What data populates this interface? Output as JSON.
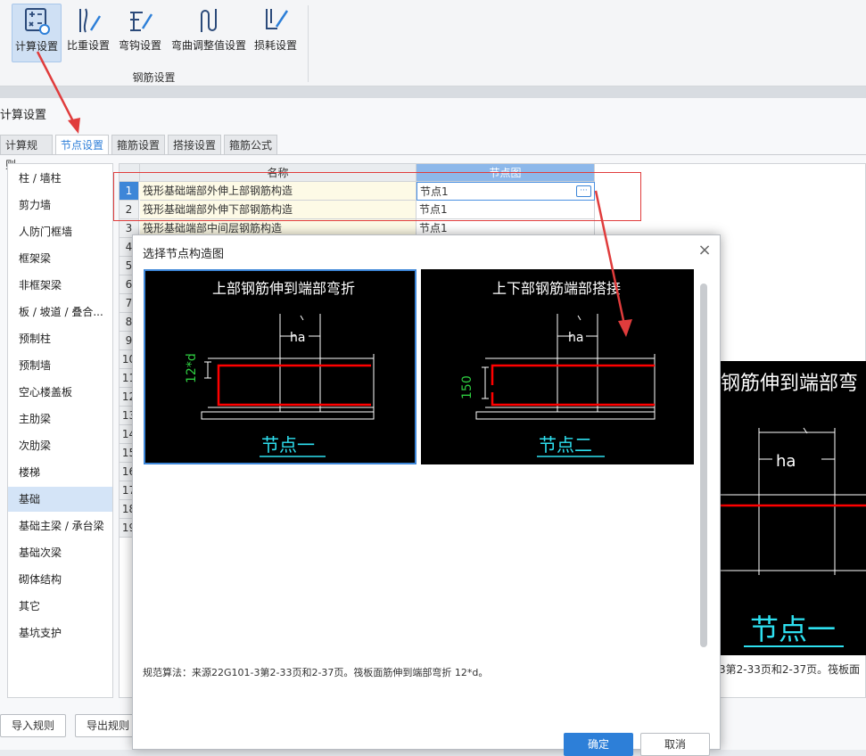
{
  "ribbon": {
    "buttons": [
      {
        "label": "计算设置",
        "icon": "calc-settings-icon"
      },
      {
        "label": "比重设置",
        "icon": "weight-settings-icon"
      },
      {
        "label": "弯钩设置",
        "icon": "hook-settings-icon"
      },
      {
        "label": "弯曲调整值设置",
        "icon": "bend-adjust-icon"
      },
      {
        "label": "损耗设置",
        "icon": "loss-settings-icon"
      }
    ],
    "group_label": "钢筋设置"
  },
  "calc_window": {
    "title": "计算设置",
    "tabs": [
      "计算规则",
      "节点设置",
      "箍筋设置",
      "搭接设置",
      "箍筋公式"
    ],
    "categories": [
      "柱 / 墙柱",
      "剪力墙",
      "人防门框墙",
      "框架梁",
      "非框架梁",
      "板 / 坡道 / 叠合...",
      "预制柱",
      "预制墙",
      "空心楼盖板",
      "主肋梁",
      "次肋梁",
      "楼梯",
      "基础",
      "基础主梁 / 承台梁",
      "基础次梁",
      "砌体结构",
      "其它",
      "基坑支护"
    ],
    "grid": {
      "headers": [
        "名称",
        "节点图"
      ],
      "rows": [
        {
          "num": "1",
          "name": "筏形基础端部外伸上部钢筋构造",
          "node": "节点1"
        },
        {
          "num": "2",
          "name": "筏形基础端部外伸下部钢筋构造",
          "node": "节点1"
        },
        {
          "num": "3",
          "name": "筏形基础端部中间层钢筋构造",
          "node": "节点1"
        }
      ],
      "hidden_row_nums": [
        "4",
        "5",
        "6",
        "7",
        "8",
        "9",
        "10",
        "11",
        "12",
        "13",
        "14",
        "15",
        "16",
        "17",
        "18",
        "19"
      ]
    },
    "import_label": "导入规则",
    "export_label": "导出规则",
    "preview": {
      "title": "钢筋伸到端部弯",
      "dim": "ha",
      "caption": "节点一",
      "note": "3第2-33页和2-37页。筏板面"
    }
  },
  "modal": {
    "title": "选择节点构造图",
    "close": "×",
    "options": [
      {
        "title": "上部钢筋伸到端部弯折",
        "dim_label": "ha",
        "side_label": "12*d",
        "caption": "节点一"
      },
      {
        "title": "上下部钢筋端部搭接",
        "dim_label": "ha",
        "side_label": "150",
        "caption": "节点二"
      }
    ],
    "rule_text": "规范算法：来源22G101-3第2-33页和2-37页。筏板面筋伸到端部弯折 12*d。",
    "ok_label": "确定",
    "cancel_label": "取消"
  },
  "colors": {
    "accent": "#2d7fd8",
    "annotation": "#e03c3c",
    "selection": "#d4e4f7"
  }
}
